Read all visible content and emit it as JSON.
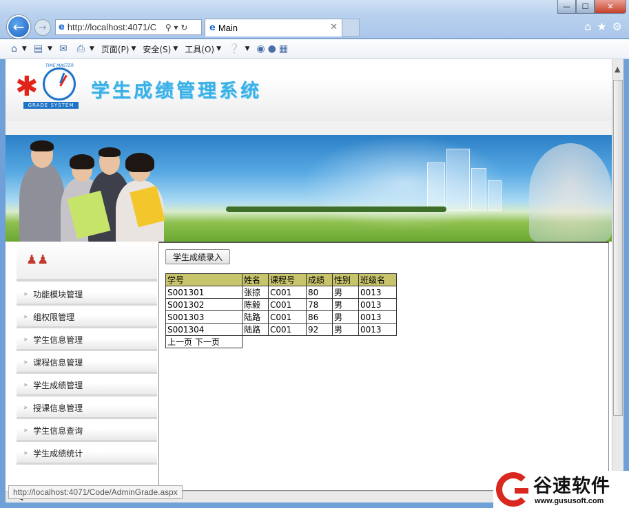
{
  "browser": {
    "address": "http://localhost:4071/C",
    "tab_title": "Main",
    "menus": [
      "页面(P)",
      "安全(S)",
      "工具(O)"
    ],
    "status_url": "http://localhost:4071/Code/AdminGrade.aspx"
  },
  "site": {
    "title": "学生成绩管理系统",
    "logo_tagline": "TIME MASTER",
    "logo_text": "GRADE SYSTEM"
  },
  "sidebar": {
    "items": [
      {
        "label": "功能模块管理"
      },
      {
        "label": "组权限管理"
      },
      {
        "label": "学生信息管理"
      },
      {
        "label": "课程信息管理"
      },
      {
        "label": "学生成绩管理"
      },
      {
        "label": "授课信息管理"
      },
      {
        "label": "学生信息查询"
      },
      {
        "label": "学生成绩统计"
      }
    ]
  },
  "main": {
    "entry_button": "学生成绩录入",
    "table": {
      "headers": [
        "学号",
        "姓名",
        "课程号",
        "成绩",
        "性别",
        "班级名"
      ],
      "rows": [
        [
          "S001301",
          "张掠",
          "C001",
          "80",
          "男",
          "0013"
        ],
        [
          "S001302",
          "陈毅",
          "C001",
          "78",
          "男",
          "0013"
        ],
        [
          "S001303",
          "陆路",
          "C001",
          "86",
          "男",
          "0013"
        ],
        [
          "S001304",
          "陆路",
          "C001",
          "92",
          "男",
          "0013"
        ]
      ]
    },
    "pager": {
      "prev": "上一页",
      "next": "下一页"
    }
  },
  "watermark": {
    "cn": "谷速软件",
    "en": "www.gususoft.com"
  },
  "colors": {
    "table_header": "#c8c46c",
    "title": "#3bb0e6",
    "brand_red": "#d9281f"
  }
}
